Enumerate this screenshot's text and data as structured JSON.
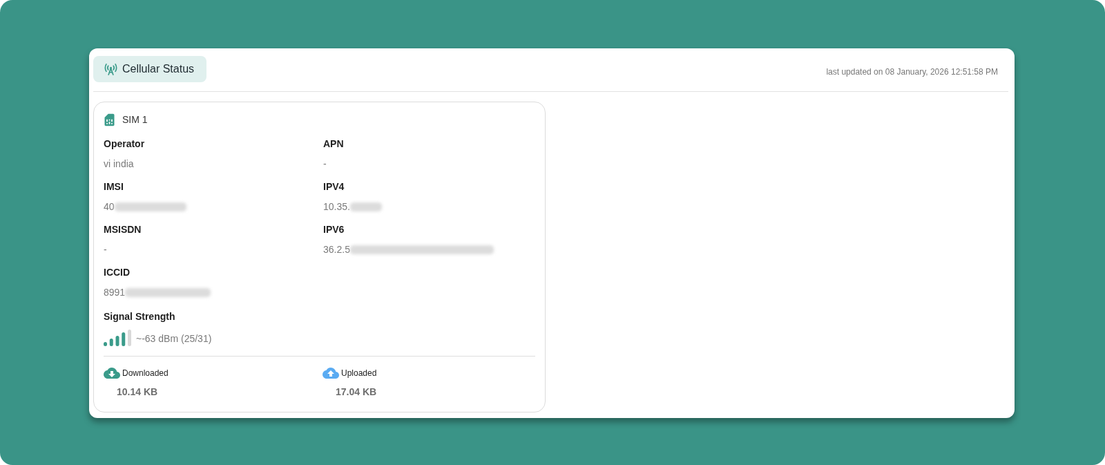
{
  "header": {
    "title": "Cellular Status",
    "last_updated": "last updated on 08 January, 2026 12:51:58 PM"
  },
  "sim": {
    "title": "SIM 1",
    "fields": [
      {
        "label": "Operator",
        "value": "vi india",
        "redacted": false
      },
      {
        "label": "APN",
        "value": "-",
        "redacted": false
      },
      {
        "label": "IMSI",
        "value": "40",
        "redacted": true
      },
      {
        "label": "IPV4",
        "value": "10.35.",
        "redacted": true
      },
      {
        "label": "MSISDN",
        "value": "-",
        "redacted": false
      },
      {
        "label": "IPV6",
        "value": "36.2.5",
        "redacted": true
      },
      {
        "label": "ICCID",
        "value": "8991",
        "redacted": true
      }
    ],
    "signal": {
      "label": "Signal Strength",
      "reading": "~-63 dBm (25/31)"
    },
    "traffic": [
      {
        "kind": "download",
        "label": "Downloaded",
        "value": "10.14 KB"
      },
      {
        "kind": "upload",
        "label": "Uploaded",
        "value": "17.04 KB"
      }
    ]
  }
}
